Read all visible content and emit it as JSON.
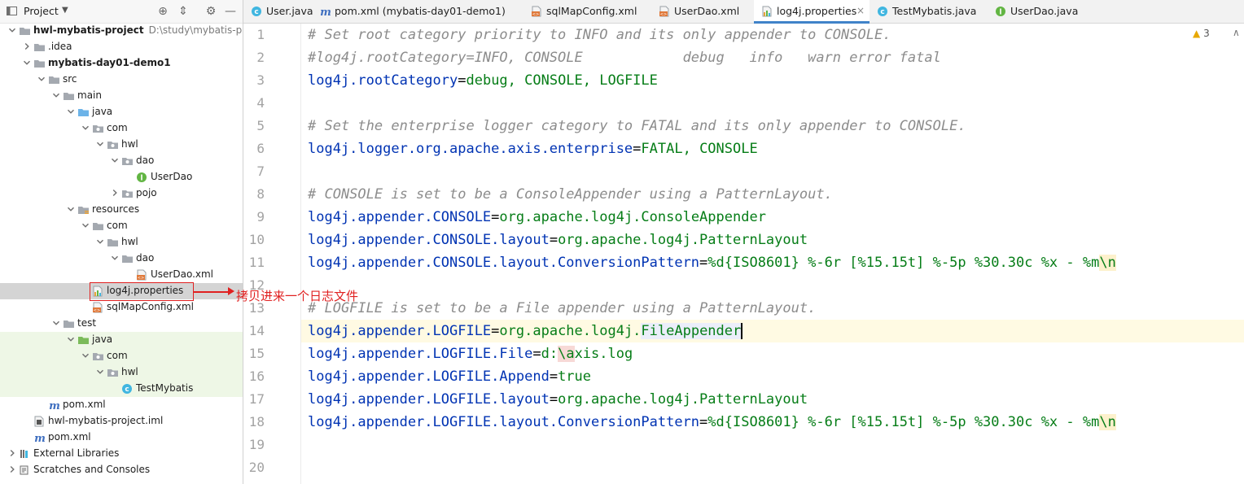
{
  "project_panel": {
    "title": "Project",
    "tree": [
      {
        "label": "hwl-mybatis-project",
        "path": "D:\\study\\mybatis-pro",
        "bold": true,
        "icon": "folder-icon",
        "expanded": true
      },
      {
        "label": ".idea",
        "icon": "folder-icon",
        "expanded": false
      },
      {
        "label": "mybatis-day01-demo1",
        "bold": true,
        "icon": "folder-icon",
        "expanded": true
      },
      {
        "label": "src",
        "icon": "folder-icon",
        "expanded": true
      },
      {
        "label": "main",
        "icon": "folder-icon",
        "expanded": true
      },
      {
        "label": "java",
        "icon": "source-folder-icon",
        "expanded": true
      },
      {
        "label": "com",
        "icon": "package-icon",
        "expanded": true
      },
      {
        "label": "hwl",
        "icon": "package-icon",
        "expanded": true
      },
      {
        "label": "dao",
        "icon": "package-icon",
        "expanded": true
      },
      {
        "label": "UserDao",
        "icon": "interface-icon"
      },
      {
        "label": "pojo",
        "icon": "package-icon",
        "expanded": false
      },
      {
        "label": "resources",
        "icon": "resources-folder-icon",
        "expanded": true
      },
      {
        "label": "com",
        "icon": "folder-icon",
        "expanded": true
      },
      {
        "label": "hwl",
        "icon": "folder-icon",
        "expanded": true
      },
      {
        "label": "dao",
        "icon": "folder-icon",
        "expanded": true
      },
      {
        "label": "UserDao.xml",
        "icon": "xml-file-icon"
      },
      {
        "label": "log4j.properties",
        "icon": "properties-file-icon",
        "selected": true
      },
      {
        "label": "sqlMapConfig.xml",
        "icon": "xml-file-icon"
      },
      {
        "label": "test",
        "icon": "folder-icon",
        "expanded": true
      },
      {
        "label": "java",
        "icon": "test-source-folder-icon",
        "expanded": true
      },
      {
        "label": "com",
        "icon": "package-icon",
        "expanded": true
      },
      {
        "label": "hwl",
        "icon": "package-icon",
        "expanded": true
      },
      {
        "label": "TestMybatis",
        "icon": "class-icon"
      },
      {
        "label": "pom.xml",
        "icon": "maven-icon"
      },
      {
        "label": "hwl-mybatis-project.iml",
        "icon": "iml-file-icon"
      },
      {
        "label": "pom.xml",
        "icon": "maven-icon"
      },
      {
        "label": "External Libraries",
        "icon": "library-icon",
        "expanded": false
      },
      {
        "label": "Scratches and Consoles",
        "icon": "scratches-icon",
        "expanded": false
      }
    ]
  },
  "tabs": [
    {
      "label": "User.java",
      "icon": "class-icon",
      "active": false
    },
    {
      "label": "pom.xml (mybatis-day01-demo1)",
      "icon": "maven-icon",
      "active": false
    },
    {
      "label": "sqlMapConfig.xml",
      "icon": "xml-file-icon",
      "active": false
    },
    {
      "label": "UserDao.xml",
      "icon": "xml-file-icon",
      "active": false
    },
    {
      "label": "log4j.properties",
      "icon": "properties-file-icon",
      "active": true
    },
    {
      "label": "TestMybatis.java",
      "icon": "class-icon",
      "active": false
    },
    {
      "label": "UserDao.java",
      "icon": "interface-icon",
      "active": false
    }
  ],
  "tab_close_glyph": "×",
  "editor": {
    "warnings_count": "3",
    "current_line": 14,
    "lines": [
      {
        "n": "1",
        "text": "# Set root category priority to INFO and its only appender to CONSOLE."
      },
      {
        "n": "2",
        "text": "#log4j.rootCategory=INFO, CONSOLE            debug   info   warn error fatal"
      },
      {
        "n": "3",
        "key": "log4j.rootCategory",
        "value": "debug, CONSOLE, LOGFILE"
      },
      {
        "n": "4",
        "text": ""
      },
      {
        "n": "5",
        "text": "# Set the enterprise logger category to FATAL and its only appender to CONSOLE."
      },
      {
        "n": "6",
        "key": "log4j.logger.org.apache.axis.enterprise",
        "value": "FATAL, CONSOLE"
      },
      {
        "n": "7",
        "text": ""
      },
      {
        "n": "8",
        "text": "# CONSOLE is set to be a ConsoleAppender using a PatternLayout."
      },
      {
        "n": "9",
        "key": "log4j.appender.CONSOLE",
        "value": "org.apache.log4j.ConsoleAppender"
      },
      {
        "n": "10",
        "key": "log4j.appender.CONSOLE.layout",
        "value": "org.apache.log4j.PatternLayout"
      },
      {
        "n": "11",
        "key": "log4j.appender.CONSOLE.layout.ConversionPattern",
        "value": "%d{ISO8601} %-6r [%15.15t] %-5p %30.30c %x - %m",
        "escape": "\\n"
      },
      {
        "n": "12",
        "text": ""
      },
      {
        "n": "13",
        "text": "# LOGFILE is set to be a File appender using a PatternLayout."
      },
      {
        "n": "14",
        "key": "log4j.appender.LOGFILE",
        "value": "org.apache.log4j.",
        "highlight": "FileAppender"
      },
      {
        "n": "15",
        "key": "log4j.appender.LOGFILE.File",
        "value": "d:",
        "bad_escape": "\\a",
        "value_after": "xis.log"
      },
      {
        "n": "16",
        "key": "log4j.appender.LOGFILE.Append",
        "value": "true"
      },
      {
        "n": "17",
        "key": "log4j.appender.LOGFILE.layout",
        "value": "org.apache.log4j.PatternLayout"
      },
      {
        "n": "18",
        "key": "log4j.appender.LOGFILE.layout.ConversionPattern",
        "value": "%d{ISO8601} %-6r [%15.15t] %-5p %30.30c %x - %m",
        "escape": "\\n"
      },
      {
        "n": "19",
        "text": ""
      },
      {
        "n": "20",
        "text": ""
      }
    ]
  },
  "annotation": {
    "text": "拷贝进来一个日志文件",
    "color": "#e02020"
  },
  "colors": {
    "key": "#0033b3",
    "value": "#067d17",
    "comment": "#8c8c8c",
    "active_tab_underline": "#4083c9"
  }
}
